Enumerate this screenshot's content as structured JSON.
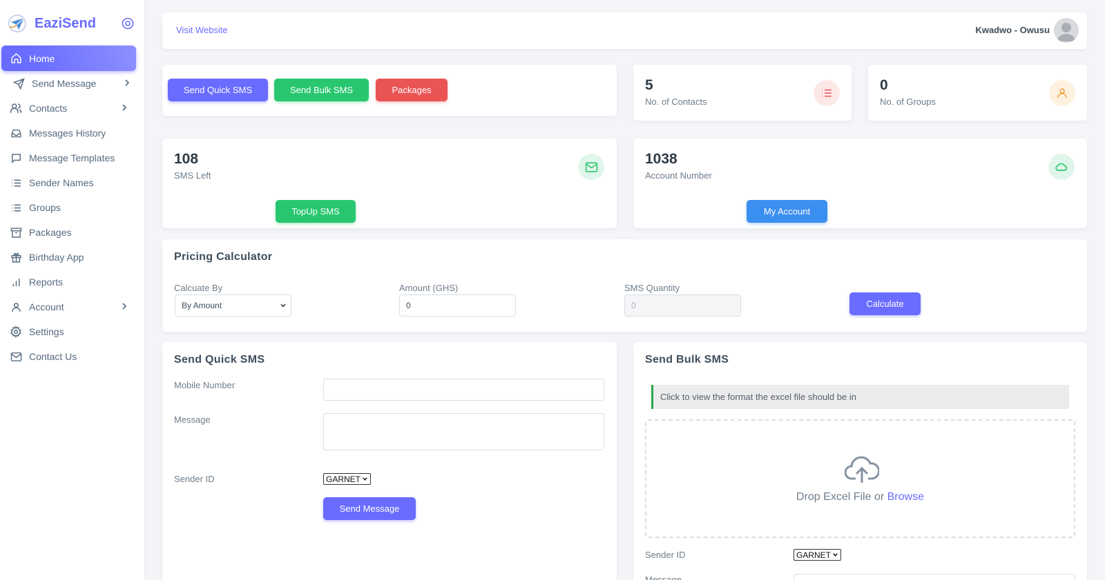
{
  "brand": {
    "name": "EaziSend"
  },
  "sidebar": {
    "items": [
      {
        "label": "Home",
        "icon": "home-icon",
        "active": true,
        "chevron": false
      },
      {
        "label": "Send Message",
        "icon": "send-icon",
        "active": false,
        "chevron": true
      },
      {
        "label": "Contacts",
        "icon": "users-icon",
        "active": false,
        "chevron": true
      },
      {
        "label": "Messages History",
        "icon": "inbox-icon",
        "active": false,
        "chevron": false
      },
      {
        "label": "Message Templates",
        "icon": "chat-icon",
        "active": false,
        "chevron": false
      },
      {
        "label": "Sender Names",
        "icon": "list-icon",
        "active": false,
        "chevron": false
      },
      {
        "label": "Groups",
        "icon": "list-icon",
        "active": false,
        "chevron": false
      },
      {
        "label": "Packages",
        "icon": "archive-icon",
        "active": false,
        "chevron": false
      },
      {
        "label": "Birthday App",
        "icon": "gift-icon",
        "active": false,
        "chevron": false
      },
      {
        "label": "Reports",
        "icon": "bar-chart-icon",
        "active": false,
        "chevron": false
      },
      {
        "label": "Account",
        "icon": "user-icon",
        "active": false,
        "chevron": true
      },
      {
        "label": "Settings",
        "icon": "gear-icon",
        "active": false,
        "chevron": false
      },
      {
        "label": "Contact Us",
        "icon": "mail-icon",
        "active": false,
        "chevron": false
      }
    ]
  },
  "header": {
    "visit_website": "Visit Website",
    "user_name": "Kwadwo - Owusu"
  },
  "quick_actions": {
    "send_quick_sms": "Send Quick SMS",
    "send_bulk_sms": "Send Bulk SMS",
    "packages": "Packages"
  },
  "stats": {
    "contacts": {
      "value": "5",
      "label": "No. of Contacts"
    },
    "groups": {
      "value": "0",
      "label": "No. of Groups"
    },
    "sms_left": {
      "value": "108",
      "label": "SMS Left",
      "button": "TopUp SMS"
    },
    "account": {
      "value": "1038",
      "label": "Account Number",
      "button": "My Account"
    }
  },
  "pricing": {
    "title": "Pricing Calculator",
    "calculate_by_label": "Calcuate By",
    "calculate_by_value": "By Amount",
    "amount_label": "Amount (GHS)",
    "amount_value": "0",
    "sms_quantity_label": "SMS Quantity",
    "sms_quantity_placeholder": "0",
    "calculate_button": "Calculate"
  },
  "quick_sms": {
    "title": "Send Quick SMS",
    "mobile_label": "Mobile Number",
    "message_label": "Message",
    "sender_label": "Sender ID",
    "sender_value": "GARNET",
    "send_button": "Send Message"
  },
  "bulk_sms": {
    "title": "Send Bulk SMS",
    "note": "Click to view the format the excel file should be in",
    "drop_text": "Drop Excel File or ",
    "browse": "Browse",
    "sender_label": "Sender ID",
    "sender_value": "GARNET",
    "message_label": "Message"
  },
  "colors": {
    "primary": "#696cff",
    "success": "#28c76f",
    "danger": "#ea5455",
    "info": "#3b8ff0"
  }
}
